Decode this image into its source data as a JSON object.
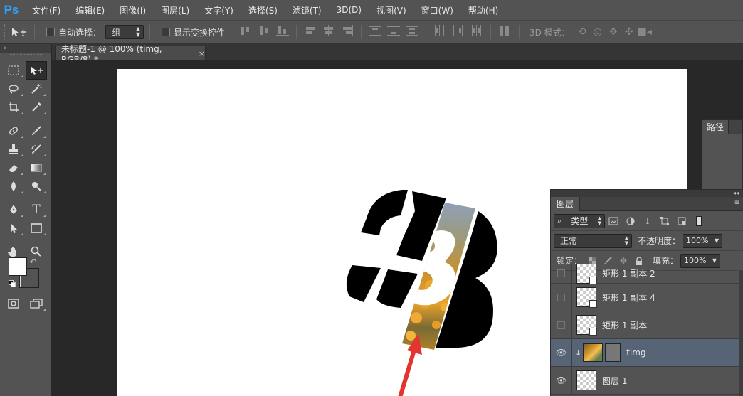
{
  "app": {
    "logo": "Ps",
    "menu": [
      "文件(F)",
      "编辑(E)",
      "图像(I)",
      "图层(L)",
      "文字(Y)",
      "选择(S)",
      "滤镜(T)",
      "3D(D)",
      "视图(V)",
      "窗口(W)",
      "帮助(H)"
    ]
  },
  "options": {
    "auto_select_label": "自动选择：",
    "auto_select_value": "组",
    "show_transform_label": "显示变换控件",
    "mode_3d_label": "3D 模式："
  },
  "document": {
    "tab_title": "未标题-1 @ 100% (timg, RGB/8) *",
    "close_glyph": "×",
    "canvas_glyph": "3"
  },
  "paths_panel": {
    "tab": "路径"
  },
  "layers_panel": {
    "tab": "图层",
    "kind_filter": "类型",
    "blend_mode": "正常",
    "opacity_label": "不透明度：",
    "opacity_value": "100%",
    "lock_label": "锁定：",
    "fill_label": "填充：",
    "fill_value": "100%",
    "layers": [
      {
        "name": "矩形 1 副本 2",
        "visible": false,
        "selected": false
      },
      {
        "name": "矩形 1 副本 4",
        "visible": false,
        "selected": false
      },
      {
        "name": "矩形 1 副本",
        "visible": false,
        "selected": false
      },
      {
        "name": "timg",
        "visible": true,
        "selected": true
      },
      {
        "name": "图层 1",
        "visible": true,
        "selected": false
      }
    ]
  },
  "colors": {
    "accent": "#2fa3ff",
    "selection": "#576476",
    "arrow": "#e3342f"
  },
  "icons": {
    "move": "move-icon",
    "marquee": "rect-marquee-icon",
    "move_tool": "move-tool-icon",
    "lasso": "lasso-icon",
    "magic": "magic-wand-icon",
    "crop": "crop-icon",
    "eyedrop": "eyedropper-icon",
    "heal": "healing-brush-icon",
    "brush": "brush-icon",
    "stamp": "clone-stamp-icon",
    "history": "history-brush-icon",
    "eraser": "eraser-icon",
    "gradient": "gradient-icon",
    "blur": "blur-icon",
    "dodge": "dodge-icon",
    "pen": "pen-icon",
    "type": "type-icon",
    "path": "path-select-icon",
    "shape": "rectangle-shape-icon",
    "hand": "hand-icon",
    "zoom": "zoom-icon"
  }
}
